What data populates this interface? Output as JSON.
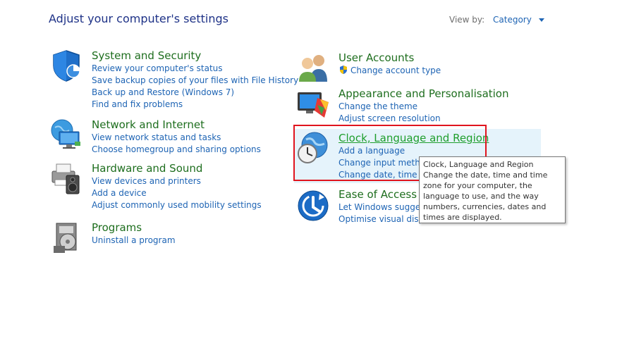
{
  "header": {
    "title": "Adjust your computer's settings",
    "view_by_label": "View by:",
    "view_by_value": "Category"
  },
  "categories": [
    {
      "title": "System and Security",
      "icon": "shield-icon",
      "links": [
        "Review your computer's status",
        "Save backup copies of your files with File History",
        "Back up and Restore (Windows 7)",
        "Find and fix problems"
      ]
    },
    {
      "title": "Network and Internet",
      "icon": "network-globe-icon",
      "links": [
        "View network status and tasks",
        "Choose homegroup and sharing options"
      ]
    },
    {
      "title": "Hardware and Sound",
      "icon": "printer-speaker-icon",
      "links": [
        "View devices and printers",
        "Add a device",
        "Adjust commonly used mobility settings"
      ]
    },
    {
      "title": "Programs",
      "icon": "programs-disc-icon",
      "links": [
        "Uninstall a program"
      ]
    },
    {
      "title": "User Accounts",
      "icon": "users-icon",
      "links": [
        "Change account type"
      ]
    },
    {
      "title": "Appearance and Personalisation",
      "icon": "monitor-paint-icon",
      "links": [
        "Change the theme",
        "Adjust screen resolution"
      ]
    },
    {
      "title": "Clock, Language and Region",
      "icon": "globe-clock-icon",
      "links": [
        "Add a language",
        "Change input method",
        "Change date, time or"
      ]
    },
    {
      "title": "Ease of Access",
      "icon": "ease-of-access-icon",
      "links": [
        "Let Windows suggest",
        "Optimise visual displa"
      ]
    }
  ],
  "tooltip": {
    "title": "Clock, Language and Region",
    "text": "Change the date, time and time zone for your computer, the language to use, and the way numbers, currencies, dates and times are displayed."
  },
  "colors": {
    "heading_green": "#1e6e1e",
    "link_blue": "#1e64b4",
    "highlight_red": "#e0141e",
    "hover_bg": "#e5f3fb"
  }
}
